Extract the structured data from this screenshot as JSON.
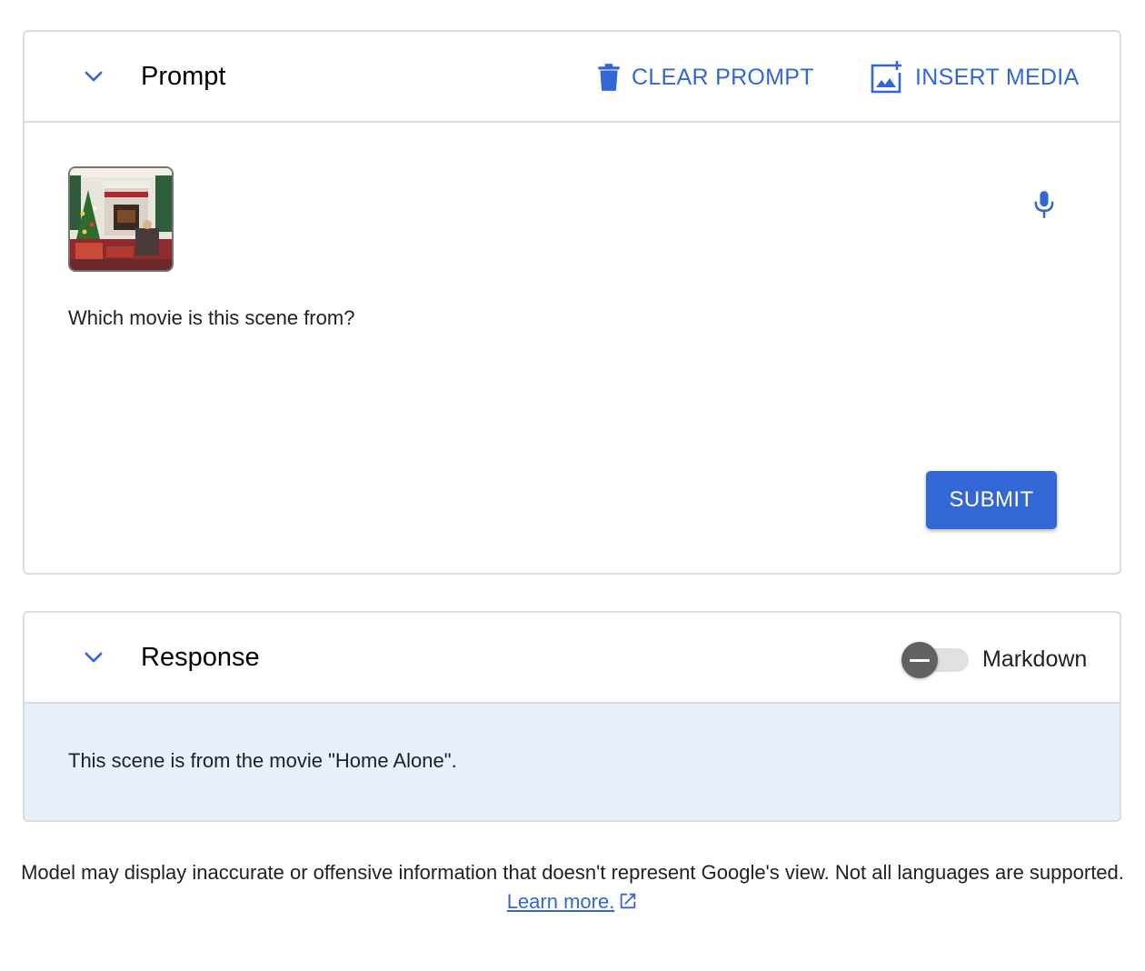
{
  "prompt": {
    "title": "Prompt",
    "clear_label": "CLEAR PROMPT",
    "insert_label": "INSERT MEDIA",
    "text": "Which movie is this scene from?",
    "submit_label": "SUBMIT"
  },
  "response": {
    "title": "Response",
    "markdown_label": "Markdown",
    "markdown_enabled": false,
    "text": "This scene is from the movie \"Home Alone\"."
  },
  "footer": {
    "disclaimer": "Model may display inaccurate or offensive information that doesn't represent Google's view. Not all languages are supported.",
    "link_label": "Learn more."
  },
  "colors": {
    "accent": "#3367d6",
    "response_bg": "#e8f0fe",
    "border": "#dadce0"
  },
  "icons": [
    "chevron-down-icon",
    "trash-icon",
    "insert-image-icon",
    "microphone-icon",
    "external-link-icon"
  ]
}
